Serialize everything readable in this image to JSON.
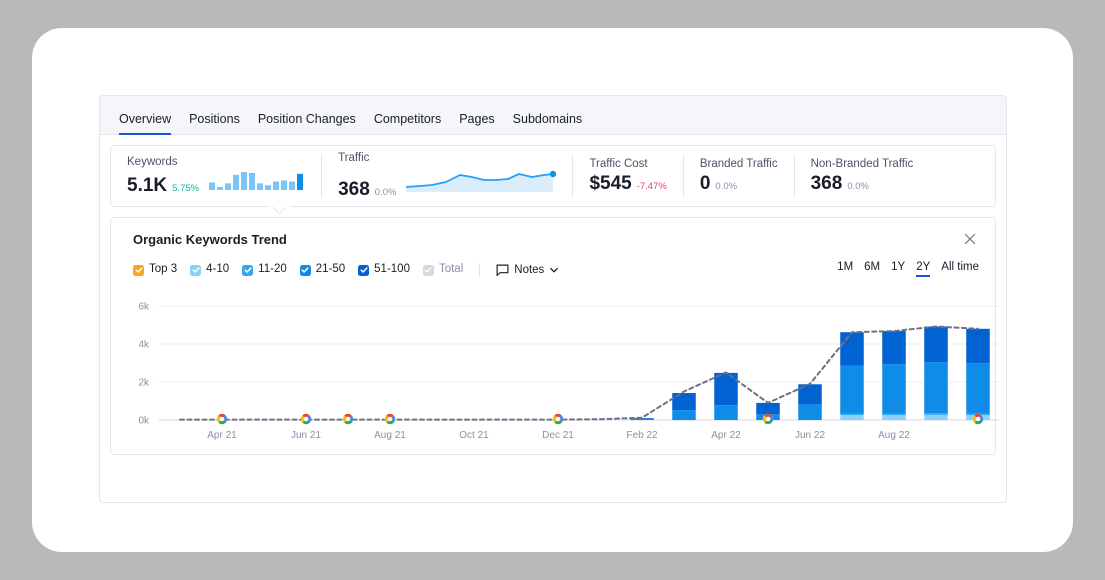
{
  "tabs": [
    {
      "label": "Overview",
      "active": true
    },
    {
      "label": "Positions",
      "active": false
    },
    {
      "label": "Position Changes",
      "active": false
    },
    {
      "label": "Competitors",
      "active": false
    },
    {
      "label": "Pages",
      "active": false
    },
    {
      "label": "Subdomains",
      "active": false
    }
  ],
  "metrics": [
    {
      "label": "Keywords",
      "value": "5.1K",
      "delta": "5.75%",
      "trend": "up",
      "spark": "bars"
    },
    {
      "label": "Traffic",
      "value": "368",
      "delta": "0.0%",
      "trend": "flat",
      "spark": "line"
    },
    {
      "label": "Traffic Cost",
      "value": "$545",
      "delta": "-7.47%",
      "trend": "down",
      "spark": "none"
    },
    {
      "label": "Branded Traffic",
      "value": "0",
      "delta": "0.0%",
      "trend": "flat",
      "spark": "none"
    },
    {
      "label": "Non-Branded Traffic",
      "value": "368",
      "delta": "0.0%",
      "trend": "flat",
      "spark": "none"
    }
  ],
  "card": {
    "title": "Organic Keywords Trend",
    "close_label": "×",
    "notes_label": "Notes"
  },
  "legend": [
    {
      "label": "Top 3",
      "color": "#f6a623",
      "checked": true,
      "enabled": true
    },
    {
      "label": "4-10",
      "color": "#8ccffa",
      "checked": true,
      "enabled": true
    },
    {
      "label": "11-20",
      "color": "#35a7ef",
      "checked": true,
      "enabled": true
    },
    {
      "label": "21-50",
      "color": "#0f8ce8",
      "checked": true,
      "enabled": true
    },
    {
      "label": "51-100",
      "color": "#0063d1",
      "checked": true,
      "enabled": true
    },
    {
      "label": "Total",
      "color": "#d6d8e0",
      "checked": true,
      "enabled": false
    }
  ],
  "ranges": [
    {
      "label": "1M",
      "active": false
    },
    {
      "label": "6M",
      "active": false
    },
    {
      "label": "1Y",
      "active": false
    },
    {
      "label": "2Y",
      "active": true
    },
    {
      "label": "All time",
      "active": false
    }
  ],
  "chart_data": {
    "type": "bar",
    "title": "Organic Keywords Trend",
    "xlabel": "",
    "ylabel": "",
    "ylim": [
      0,
      6000
    ],
    "yticks": [
      0,
      2000,
      4000,
      6000
    ],
    "ytick_labels": [
      "0k",
      "2k",
      "4k",
      "6k"
    ],
    "grid": true,
    "legend_position": "top-left",
    "stacked": true,
    "x": [
      "Mar 21",
      "Apr 21",
      "May 21",
      "Jun 21",
      "Jul 21",
      "Aug 21",
      "Sep 21",
      "Oct 21",
      "Nov 21",
      "Dec 21",
      "Jan 22",
      "Feb 22",
      "Mar 22",
      "Apr 22",
      "May 22",
      "Jun 22",
      "Jul 22",
      "Aug 22",
      "Sep 22",
      "Oct 22"
    ],
    "xtick_labels": [
      "Apr 21",
      "Jun 21",
      "Aug 21",
      "Oct 21",
      "Dec 21",
      "Feb 22",
      "Apr 22",
      "Jun 22",
      "Aug 22"
    ],
    "series": [
      {
        "name": "Top 3",
        "color": "#f6a623",
        "values": [
          0,
          0,
          0,
          0,
          0,
          0,
          0,
          0,
          0,
          0,
          0,
          0,
          0,
          0,
          0,
          0,
          0,
          0,
          0,
          0
        ]
      },
      {
        "name": "4-10",
        "color": "#8ccffa",
        "values": [
          0,
          0,
          0,
          0,
          0,
          0,
          0,
          0,
          0,
          0,
          0,
          0,
          0,
          0,
          0,
          0,
          260,
          260,
          270,
          260
        ]
      },
      {
        "name": "11-20",
        "color": "#35a7ef",
        "values": [
          0,
          0,
          0,
          0,
          0,
          0,
          0,
          0,
          0,
          0,
          0,
          0,
          0,
          0,
          0,
          0,
          80,
          80,
          80,
          80
        ]
      },
      {
        "name": "21-50",
        "color": "#0f8ce8",
        "values": [
          0,
          0,
          0,
          0,
          0,
          0,
          0,
          0,
          0,
          0,
          0,
          60,
          520,
          780,
          300,
          820,
          2520,
          2600,
          2700,
          2650
        ]
      },
      {
        "name": "51-100",
        "color": "#0063d1",
        "values": [
          0,
          0,
          0,
          0,
          0,
          0,
          0,
          0,
          0,
          0,
          0,
          40,
          900,
          1700,
          600,
          1060,
          1760,
          1740,
          1870,
          1810
        ]
      }
    ],
    "total_line": {
      "name": "Total",
      "style": "dashed",
      "color": "#6c7086",
      "values": [
        20,
        20,
        20,
        20,
        20,
        20,
        20,
        20,
        20,
        20,
        40,
        120,
        1500,
        2500,
        900,
        1900,
        4620,
        4680,
        4920,
        4800
      ]
    },
    "google_update_markers": [
      "Apr 21",
      "Jun 21",
      "Jul 21",
      "Aug 21",
      "Dec 21",
      "May 22",
      "Oct 22"
    ]
  }
}
